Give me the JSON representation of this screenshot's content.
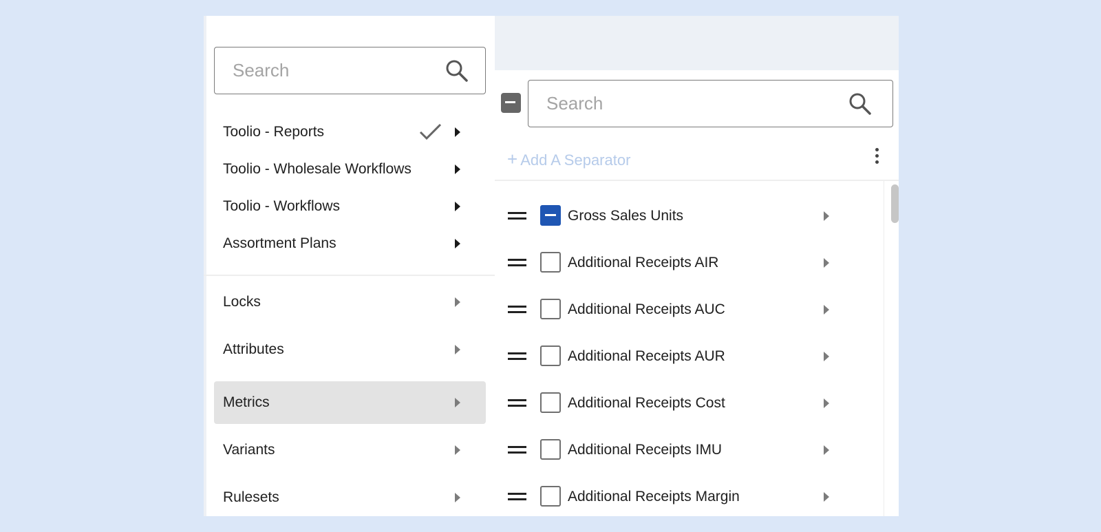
{
  "left_search": {
    "placeholder": "Search"
  },
  "menu": {
    "groups": [
      {
        "label": "Toolio - Reports",
        "checked": true
      },
      {
        "label": "Toolio - Wholesale Workflows",
        "checked": false
      },
      {
        "label": "Toolio - Workflows",
        "checked": false
      },
      {
        "label": "Assortment Plans",
        "checked": false
      }
    ],
    "sections": [
      {
        "label": "Locks",
        "active": false
      },
      {
        "label": "Attributes",
        "active": false
      },
      {
        "label": "Metrics",
        "active": true
      },
      {
        "label": "Variants",
        "active": false
      },
      {
        "label": "Rulesets",
        "active": false
      }
    ]
  },
  "right_search": {
    "placeholder": "Search"
  },
  "add_separator": {
    "icon": "plus-icon",
    "label": "Add A Separator"
  },
  "metrics_list": [
    {
      "label": "Gross Sales Units",
      "state": "indeterminate"
    },
    {
      "label": "Additional Receipts AIR",
      "state": "unchecked"
    },
    {
      "label": "Additional Receipts AUC",
      "state": "unchecked"
    },
    {
      "label": "Additional Receipts AUR",
      "state": "unchecked"
    },
    {
      "label": "Additional Receipts Cost",
      "state": "unchecked"
    },
    {
      "label": "Additional Receipts IMU",
      "state": "unchecked"
    },
    {
      "label": "Additional Receipts Margin",
      "state": "unchecked"
    }
  ],
  "colors": {
    "accent": "#1f56b3",
    "active_row": "#e3e3e3",
    "separator_link": "#b6cbea",
    "background": "#dbe7f8"
  }
}
